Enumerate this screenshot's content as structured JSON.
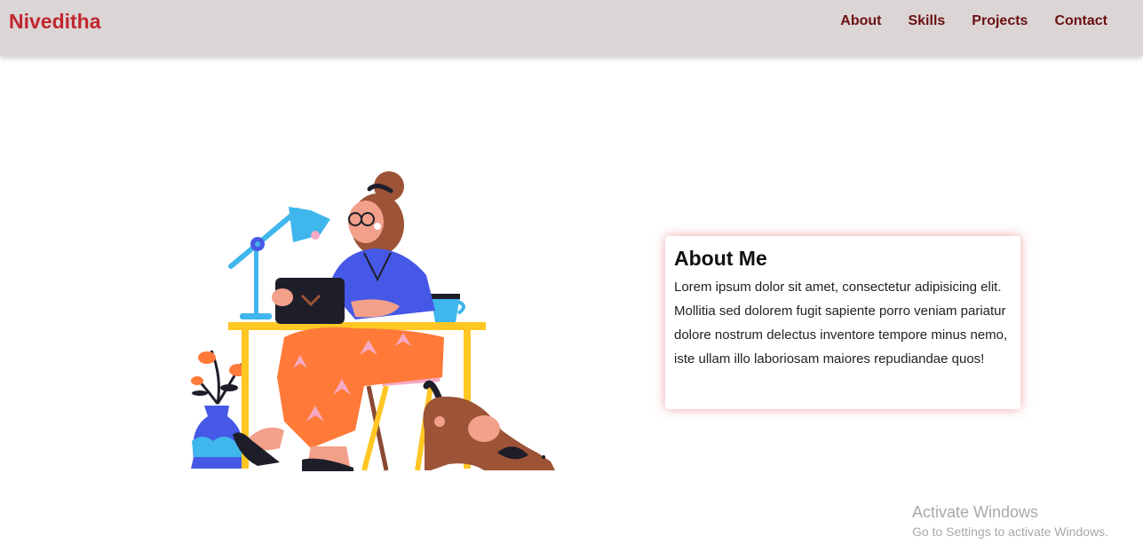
{
  "navbar": {
    "brand": "Niveditha",
    "links": [
      {
        "label": "About"
      },
      {
        "label": "Skills"
      },
      {
        "label": "Projects"
      },
      {
        "label": "Contact"
      }
    ]
  },
  "illustration": {
    "icon": "woman-working-at-desk-illustration"
  },
  "about": {
    "title": "About Me",
    "text": "Lorem ipsum dolor sit amet, consectetur adipisicing elit. Mollitia sed dolorem fugit sapiente porro veniam pariatur dolore nostrum delectus inventore tempore minus nemo, iste ullam illo laboriosam maiores repudiandae quos!"
  },
  "watermark": {
    "title": "Activate Windows",
    "subtitle": "Go to Settings to activate Windows."
  },
  "colors": {
    "navbar_bg": "#dcd5d6",
    "brand": "#c0272d",
    "nav_link": "#6b1012",
    "card_glow": "#e65a64"
  }
}
